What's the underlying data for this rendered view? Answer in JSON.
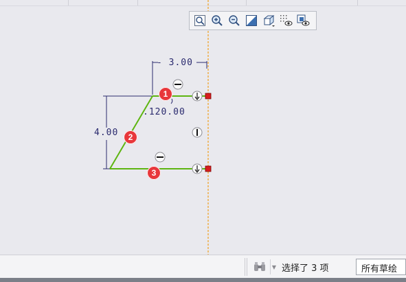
{
  "graphics_toolbar": {
    "buttons": [
      {
        "name": "refit-icon",
        "title": "Refit"
      },
      {
        "name": "zoom-in-icon",
        "title": "Zoom In"
      },
      {
        "name": "zoom-out-icon",
        "title": "Zoom Out"
      },
      {
        "name": "repaint-icon",
        "title": "Repaint"
      },
      {
        "name": "display-style-icon",
        "title": "Display Style"
      },
      {
        "name": "datum-display-icon",
        "title": "Datum Display Filters"
      },
      {
        "name": "sketcher-display-icon",
        "title": "Sketcher Display Filters"
      }
    ]
  },
  "sketch": {
    "dimensions": {
      "horizontal": "3.00",
      "angle": "120.00",
      "vertical": "4.00"
    },
    "badges": [
      "1",
      "2",
      "3"
    ],
    "colors": {
      "selected_line": "#5db510",
      "dimension": "#2a2a6e",
      "centerline": "#f0a020",
      "endpoint": "#d81e1e",
      "badge": "#e8373b"
    }
  },
  "status_bar": {
    "selection_text": "选择了 3 项",
    "filter_value": "所有草绘"
  }
}
